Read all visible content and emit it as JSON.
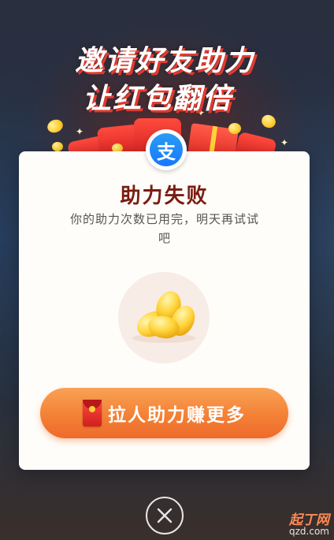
{
  "banner": {
    "title_line1": "邀请好友助力",
    "title_line2": "让红包翻倍"
  },
  "logo": {
    "glyph": "支",
    "icon": "alipay-logo-icon",
    "color": "#1677ff"
  },
  "dialog": {
    "title": "助力失败",
    "message": "你的助力次数已用完，明天再试试吧",
    "beans_icon": "gold-beans-icon",
    "cta_icon": "red-envelope-icon",
    "cta_label": "拉人助力赚更多"
  },
  "close": {
    "icon": "close-icon"
  },
  "watermark": {
    "line1": "起丁网",
    "line2": "qzd.com"
  },
  "colors": {
    "title_red": "#7a1c12",
    "cta_start": "#f9a255",
    "cta_end": "#ee6a2a",
    "banner_shadow": "#e23a2e"
  }
}
